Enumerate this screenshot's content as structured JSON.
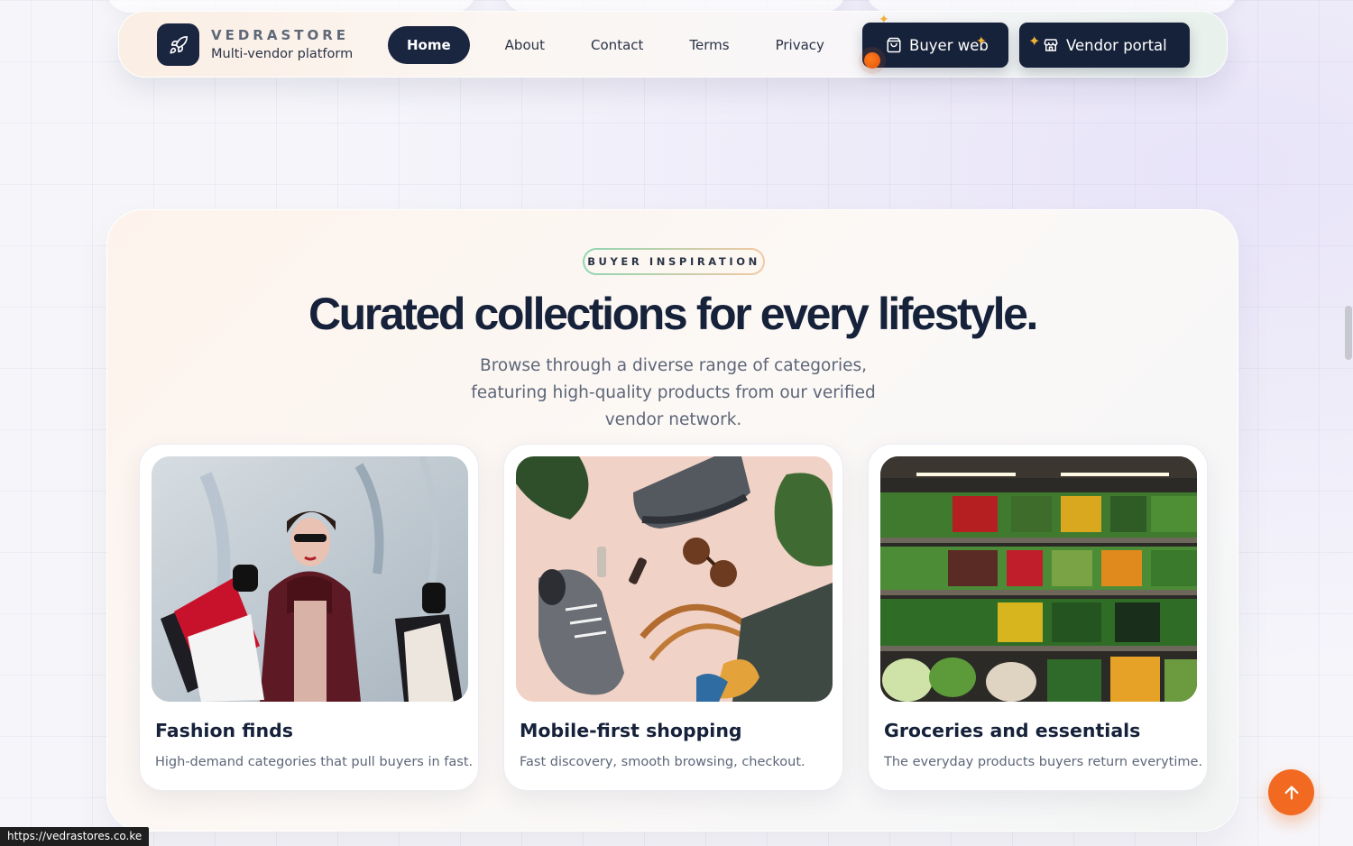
{
  "brand": {
    "name": "VEDRASTORE",
    "tagline": "Multi-vendor platform"
  },
  "nav": {
    "links": [
      {
        "label": "Home",
        "active": true
      },
      {
        "label": "About"
      },
      {
        "label": "Contact"
      },
      {
        "label": "Terms"
      },
      {
        "label": "Privacy"
      }
    ],
    "buyer_button": "Buyer web",
    "vendor_button": "Vendor portal"
  },
  "section": {
    "eyebrow": "BUYER INSPIRATION",
    "headline": "Curated collections for every lifestyle.",
    "subtext": "Browse through a diverse range of categories, featuring high-quality products from our verified vendor network."
  },
  "cards": [
    {
      "title": "Fashion finds",
      "description": "High-demand categories that pull buyers in fast.",
      "image_subject": "woman with shopping bags"
    },
    {
      "title": "Mobile-first shopping",
      "description": "Fast discovery, smooth browsing, checkout.",
      "image_subject": "flat lay of sneakers, sunglasses and tote bag"
    },
    {
      "title": "Groceries and essentials",
      "description": "The everyday products buyers return everytime.",
      "image_subject": "supermarket produce shelves"
    }
  ],
  "status_bar": {
    "url": "https://vedrastores.co.ke"
  },
  "colors": {
    "navy": "#16213a",
    "accent_orange": "#f26a21",
    "sparkle_gold": "#f3b234"
  },
  "icons": {
    "brand": "rocket-icon",
    "buyer": "shopping-bag-icon",
    "vendor": "storefront-icon",
    "scroll_top": "arrow-up-icon"
  }
}
